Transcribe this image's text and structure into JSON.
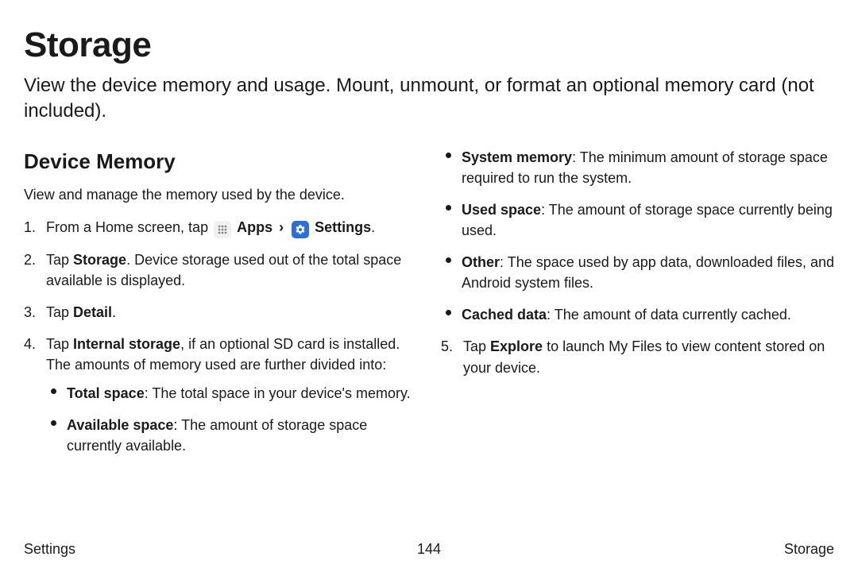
{
  "page": {
    "title": "Storage",
    "intro": "View the device memory and usage. Mount, unmount, or format an optional memory card (not included)."
  },
  "section": {
    "heading": "Device Memory",
    "subintro": "View and manage the memory used by the device."
  },
  "icons": {
    "apps_label": "Apps",
    "settings_label": "Settings",
    "caret": "›"
  },
  "steps": {
    "s1_prefix": "From a Home screen, tap ",
    "s1_suffix": ".",
    "s2_a": "Tap ",
    "s2_bold": "Storage",
    "s2_b": ". Device storage used out of the total space available is displayed.",
    "s3_a": "Tap ",
    "s3_bold": "Detail",
    "s3_b": ".",
    "s4_a": "Tap ",
    "s4_bold": "Internal storage",
    "s4_b": ", if an optional SD card is installed. The amounts of memory used are further divided into:",
    "s5_a": "Tap ",
    "s5_bold": "Explore",
    "s5_b": " to launch My Files to view content stored on your device."
  },
  "bullets_left": {
    "b1_bold": "Total space",
    "b1_rest": ": The total space in your device's memory.",
    "b2_bold": "Available space",
    "b2_rest": ": The amount of storage space currently available."
  },
  "bullets_right": {
    "b3_bold": "System memory",
    "b3_rest": ": The minimum amount of storage space required to run the system.",
    "b4_bold": "Used space",
    "b4_rest": ": The amount of storage space currently being used.",
    "b5_bold": "Other",
    "b5_rest": ": The space used by app data, downloaded files, and Android system files.",
    "b6_bold": "Cached data",
    "b6_rest": ": The amount of data currently cached."
  },
  "footer": {
    "left": "Settings",
    "center": "144",
    "right": "Storage"
  }
}
